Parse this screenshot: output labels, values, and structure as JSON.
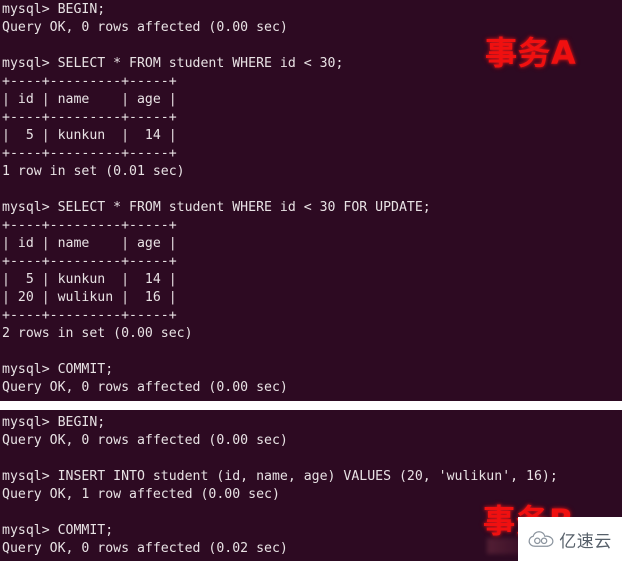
{
  "window": {
    "background_color": "#2d0a22",
    "text_color": "#e8e2e4",
    "annotation_color": "#f01010"
  },
  "pane_a": {
    "name": "transaction-a-terminal",
    "annotation": "事务A",
    "lines": [
      "mysql> BEGIN;",
      "Query OK, 0 rows affected (0.00 sec)",
      "",
      "mysql> SELECT * FROM student WHERE id < 30;",
      "+----+---------+-----+",
      "| id | name    | age |",
      "+----+---------+-----+",
      "|  5 | kunkun  |  14 |",
      "+----+---------+-----+",
      "1 row in set (0.01 sec)",
      "",
      "mysql> SELECT * FROM student WHERE id < 30 FOR UPDATE;",
      "+----+---------+-----+",
      "| id | name    | age |",
      "+----+---------+-----+",
      "|  5 | kunkun  |  14 |",
      "| 20 | wulikun |  16 |",
      "+----+---------+-----+",
      "2 rows in set (0.00 sec)",
      "",
      "mysql> COMMIT;",
      "Query OK, 0 rows affected (0.00 sec)"
    ]
  },
  "pane_b": {
    "name": "transaction-b-terminal",
    "annotation": "事务B",
    "lines": [
      "mysql> BEGIN;",
      "Query OK, 0 rows affected (0.00 sec)",
      "",
      "mysql> INSERT INTO student (id, name, age) VALUES (20, 'wulikun', 16);",
      "Query OK, 1 row affected (0.00 sec)",
      "",
      "mysql> COMMIT;",
      "Query OK, 0 rows affected (0.02 sec)"
    ]
  },
  "watermark": {
    "text": "亿速云",
    "icon": "cloud-icon"
  }
}
